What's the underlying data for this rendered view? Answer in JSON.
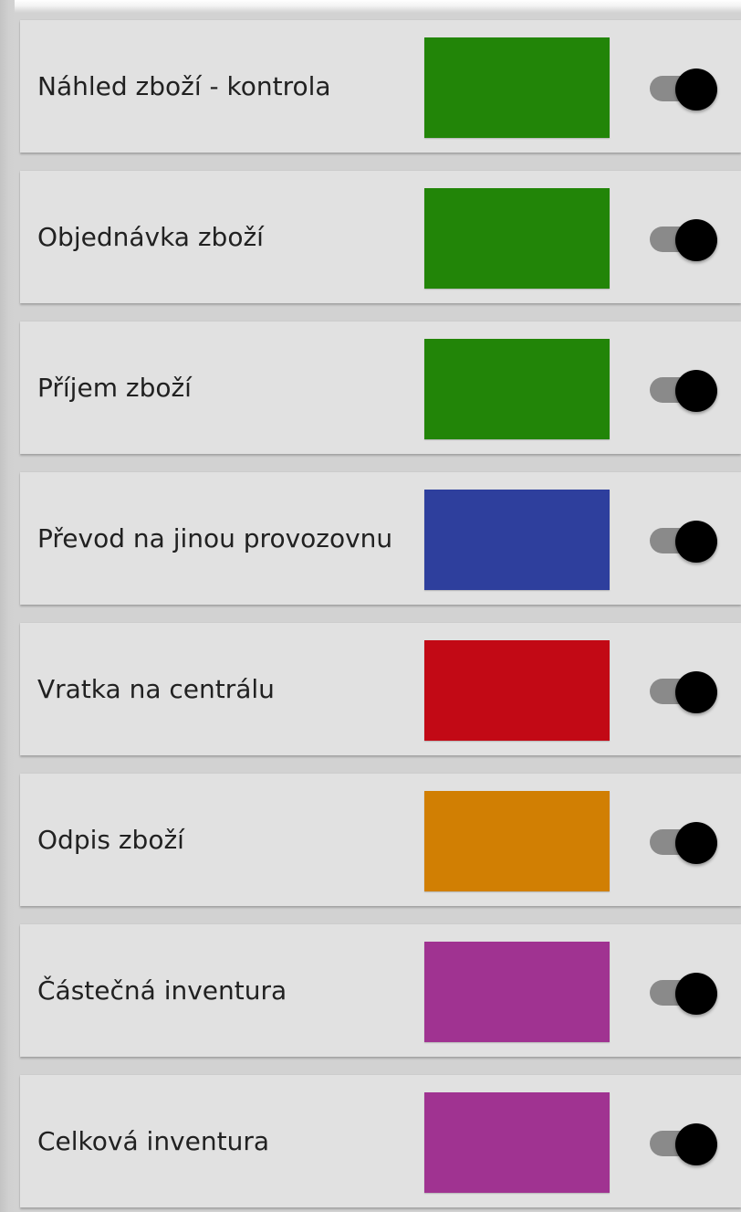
{
  "settings": {
    "items": [
      {
        "label": "Náhled zboží - kontrola",
        "color": "#228508",
        "enabled": true
      },
      {
        "label": "Objednávka zboží",
        "color": "#228508",
        "enabled": true
      },
      {
        "label": "Příjem zboží",
        "color": "#228508",
        "enabled": true
      },
      {
        "label": "Převod na jinou provozovnu",
        "color": "#2e3f9d",
        "enabled": true
      },
      {
        "label": "Vratka na centrálu",
        "color": "#c20915",
        "enabled": true
      },
      {
        "label": "Odpis zboží",
        "color": "#d17f03",
        "enabled": true
      },
      {
        "label": "Částečná inventura",
        "color": "#a03391",
        "enabled": true
      },
      {
        "label": "Celková inventura",
        "color": "#a03391",
        "enabled": true
      }
    ]
  },
  "icons": {
    "toggle": "toggle-switch-on-icon"
  }
}
